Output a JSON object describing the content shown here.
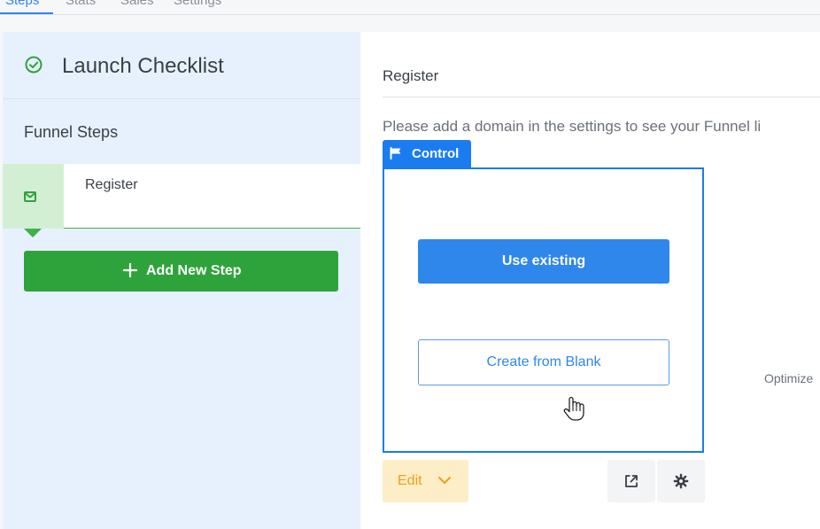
{
  "top_tabs": [
    {
      "label": "Steps",
      "active": true
    },
    {
      "label": "Stats",
      "active": false
    },
    {
      "label": "Sales",
      "active": false
    },
    {
      "label": "Settings",
      "active": false
    }
  ],
  "sidebar": {
    "title": "Launch Checklist",
    "section_label": "Funnel Steps",
    "steps": [
      {
        "name": "Register",
        "icon": "mail-icon",
        "selected": true
      }
    ],
    "add_step_label": "Add New Step"
  },
  "main": {
    "page_title": "Register",
    "notice": "Please add a domain in the settings to see your Funnel li",
    "variant": {
      "tag_label": "Control",
      "use_existing_label": "Use existing",
      "create_blank_label": "Create from Blank"
    },
    "edit_label": "Edit",
    "side_text": "Optimize"
  },
  "colors": {
    "accent_blue": "#1b7cf0",
    "button_blue": "#2f86eb",
    "success_green": "#2ea33b",
    "sidebar_bg": "#e6f1fd",
    "edit_bg": "#fdeec7",
    "edit_text": "#eaa11b"
  }
}
